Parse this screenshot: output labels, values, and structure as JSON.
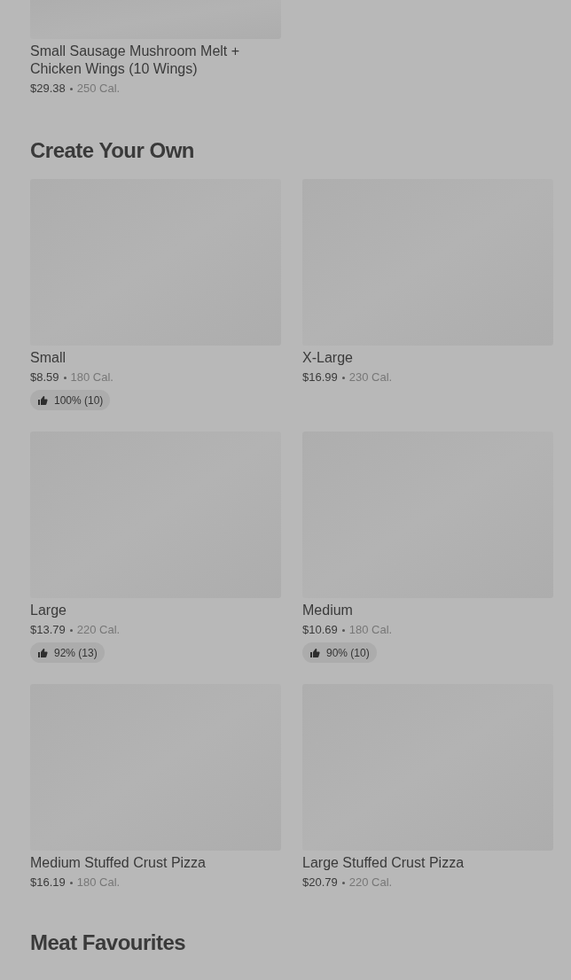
{
  "previous_item": {
    "name": "Small Sausage Mushroom Melt + Chicken Wings (10 Wings)",
    "price": "$29.38",
    "calories": "250 Cal."
  },
  "sections": [
    {
      "title": "Create Your Own",
      "items": [
        {
          "name": "Small",
          "price": "$8.59",
          "calories": "180 Cal.",
          "rating": "100% (10)"
        },
        {
          "name": "X-Large",
          "price": "$16.99",
          "calories": "230 Cal."
        },
        {
          "name": "Large",
          "price": "$13.79",
          "calories": "220 Cal.",
          "rating": "92% (13)"
        },
        {
          "name": "Medium",
          "price": "$10.69",
          "calories": "180 Cal.",
          "rating": "90% (10)"
        },
        {
          "name": "Medium Stuffed Crust Pizza",
          "price": "$16.19",
          "calories": "180 Cal."
        },
        {
          "name": "Large Stuffed Crust Pizza",
          "price": "$20.79",
          "calories": "220 Cal."
        }
      ]
    },
    {
      "title": "Meat Favourites"
    }
  ]
}
